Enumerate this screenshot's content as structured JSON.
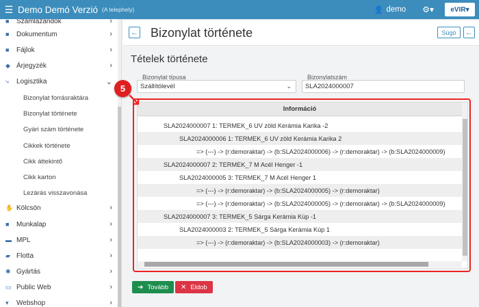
{
  "topbar": {
    "app_title": "Demo Demó Verzió",
    "app_subtitle": "(A telephely)",
    "user_name": "demo",
    "logo_text": "eVIR"
  },
  "sidebar": {
    "items": [
      {
        "label": "Számlázandók",
        "icon": "file-icon"
      },
      {
        "label": "Dokumentum",
        "icon": "file-icon"
      },
      {
        "label": "Fájlok",
        "icon": "file-icon"
      },
      {
        "label": "Árjegyzék",
        "icon": "tag-icon"
      },
      {
        "label": "Logisztika",
        "icon": "route-icon"
      },
      {
        "label": "Kölcsön",
        "icon": "handshake-icon"
      },
      {
        "label": "Munkalap",
        "icon": "file-icon"
      },
      {
        "label": "MPL",
        "icon": "truck-icon"
      },
      {
        "label": "Flotta",
        "icon": "car-icon"
      },
      {
        "label": "Gyártás",
        "icon": "cogs-icon"
      },
      {
        "label": "Public Web",
        "icon": "globe-icon"
      },
      {
        "label": "Webshop",
        "icon": "cart-icon"
      }
    ],
    "subitems": [
      "Bizonylat forrásraktára",
      "Bizonylat története",
      "Gyári szám története",
      "Cikkek története",
      "Cikk áttekintő",
      "Cikk karton",
      "Lezárás visszavonása"
    ]
  },
  "header": {
    "title": "Bizonylat története",
    "help_label": "Súgó"
  },
  "main": {
    "section_title": "Tételek története",
    "doc_type_label": "Bizonylat típusa",
    "doc_type_value": "Szállítólevél",
    "doc_number_label": "Bizonylatszám",
    "doc_number_value": "SLA2024000007"
  },
  "table": {
    "header": "Információ",
    "rows": [
      "SLA2024000007 1: TERMEK_6 UV zöld Kerámia Karika -2",
      "SLA2024000006 1: TERMEK_6 UV zöld Kerámia Karika 2",
      "=> (---) -> (r:demoraktar) -> (b:SLA2024000006) -> (r:demoraktar) -> (b:SLA2024000009)",
      "SLA2024000007 2: TERMEK_7 M Acél Henger -1",
      "SLA2024000005 3: TERMEK_7 M Acél Henger 1",
      "=> (---) -> (r:demoraktar) -> (b:SLA2024000005) -> (r:demoraktar)",
      "=> (---) -> (r:demoraktar) -> (b:SLA2024000005) -> (r:demoraktar) -> (b:SLA2024000009)",
      "SLA2024000007 3: TERMEK_5 Sárga Kerámia Kúp -1",
      "SLA2024000003 2: TERMEK_5 Sárga Kerámia Kúp 1",
      "=> (---) -> (r:demoraktar) -> (b:SLA2024000003) -> (r:demoraktar)"
    ]
  },
  "annotation": {
    "badge_number": "5"
  },
  "buttons": {
    "next_label": "Tovább",
    "discard_label": "Eldob"
  },
  "colors": {
    "topbar": "#3c8dbc",
    "highlight": "#e22222",
    "next_button": "#1e8e4e",
    "discard_button": "#dc3545"
  }
}
